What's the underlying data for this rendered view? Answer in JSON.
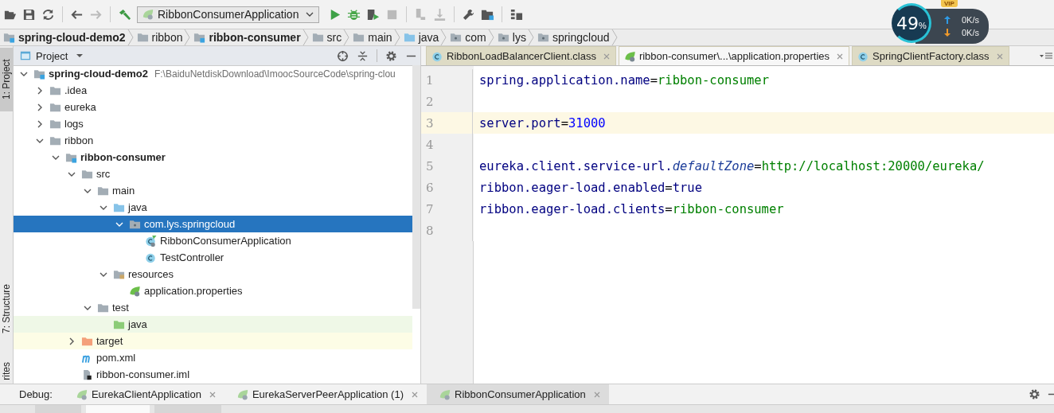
{
  "toolbar": {
    "items": [
      {
        "kind": "open",
        "disabled": false
      },
      {
        "kind": "save",
        "disabled": false
      },
      {
        "kind": "sync",
        "disabled": false
      },
      {
        "kind": "separator"
      },
      {
        "kind": "back",
        "disabled": false
      },
      {
        "kind": "forward",
        "disabled": true
      },
      {
        "kind": "separator"
      },
      {
        "kind": "build",
        "disabled": false
      },
      {
        "kind": "run-config",
        "label": "RibbonConsumerApplication"
      },
      {
        "kind": "run",
        "disabled": false
      },
      {
        "kind": "debug",
        "disabled": false
      },
      {
        "kind": "coverage",
        "disabled": false
      },
      {
        "kind": "stop",
        "disabled": true
      },
      {
        "kind": "separator"
      },
      {
        "kind": "attach",
        "disabled": true
      },
      {
        "kind": "deploy",
        "disabled": true
      },
      {
        "kind": "separator"
      },
      {
        "kind": "settings",
        "disabled": false
      },
      {
        "kind": "structure",
        "disabled": false
      },
      {
        "kind": "separator"
      },
      {
        "kind": "tasks",
        "disabled": false
      }
    ]
  },
  "breadcrumbs": [
    {
      "label": "spring-cloud-demo2",
      "kind": "module"
    },
    {
      "label": "ribbon",
      "kind": "folder"
    },
    {
      "label": "ribbon-consumer",
      "kind": "module"
    },
    {
      "label": "src",
      "kind": "folder"
    },
    {
      "label": "main",
      "kind": "folder"
    },
    {
      "label": "java",
      "kind": "source-root"
    },
    {
      "label": "com",
      "kind": "package"
    },
    {
      "label": "lys",
      "kind": "package"
    },
    {
      "label": "springcloud",
      "kind": "package"
    }
  ],
  "side_stripe": {
    "top": "1: Project",
    "middle": "7: Structure",
    "bottom": "rites"
  },
  "project_panel": {
    "title": "Project",
    "tree": [
      {
        "label": "spring-cloud-demo2",
        "kind": "module",
        "hint": "F:\\BaiduNetdiskDownload\\ImoocSourceCode\\spring-clou",
        "expanded": true,
        "selected": false,
        "children": [
          {
            "label": ".idea",
            "kind": "folder",
            "expanded": false,
            "selected": false
          },
          {
            "label": "eureka",
            "kind": "folder",
            "expanded": false,
            "selected": false
          },
          {
            "label": "logs",
            "kind": "folder",
            "expanded": false,
            "selected": false
          },
          {
            "label": "ribbon",
            "kind": "folder",
            "expanded": true,
            "selected": false,
            "children": [
              {
                "label": "ribbon-consumer",
                "kind": "module",
                "expanded": true,
                "selected": false,
                "children": [
                  {
                    "label": "src",
                    "kind": "folder",
                    "expanded": true,
                    "selected": false,
                    "children": [
                      {
                        "label": "main",
                        "kind": "folder",
                        "expanded": true,
                        "selected": false,
                        "children": [
                          {
                            "label": "java",
                            "kind": "source-root",
                            "expanded": true,
                            "selected": false,
                            "children": [
                              {
                                "label": "com.lys.springcloud",
                                "kind": "package",
                                "expanded": true,
                                "selected": true,
                                "children": [
                                  {
                                    "label": "RibbonConsumerApplication",
                                    "kind": "spring-class",
                                    "selected": false
                                  },
                                  {
                                    "label": "TestController",
                                    "kind": "class",
                                    "selected": false
                                  }
                                ]
                              }
                            ]
                          },
                          {
                            "label": "resources",
                            "kind": "resources",
                            "expanded": true,
                            "selected": false,
                            "children": [
                              {
                                "label": "application.properties",
                                "kind": "properties",
                                "selected": false
                              }
                            ]
                          }
                        ]
                      },
                      {
                        "label": "test",
                        "kind": "folder",
                        "expanded": true,
                        "selected": false,
                        "children": [
                          {
                            "label": "java",
                            "kind": "test-root",
                            "selected": false
                          }
                        ]
                      }
                    ]
                  },
                  {
                    "label": "target",
                    "kind": "excluded",
                    "expanded": false,
                    "selected": false
                  },
                  {
                    "label": "pom.xml",
                    "kind": "maven",
                    "selected": false
                  },
                  {
                    "label": "ribbon-consumer.iml",
                    "kind": "iml",
                    "selected": false
                  }
                ]
              }
            ]
          }
        ]
      }
    ]
  },
  "editor": {
    "tabs": [
      {
        "label": "RibbonLoadBalancerClient.class",
        "kind": "class",
        "selected": false
      },
      {
        "label": "ribbon-consumer\\...\\application.properties",
        "kind": "properties",
        "selected": true
      },
      {
        "label": "SpringClientFactory.class",
        "kind": "class",
        "selected": false
      }
    ],
    "lines": [
      {
        "number": "1",
        "current": false,
        "tokens": [
          {
            "text": "spring.application.name",
            "kind": "key"
          },
          {
            "text": "=",
            "kind": "sep"
          },
          {
            "text": "ribbon-consumer",
            "kind": "string"
          }
        ]
      },
      {
        "number": "2",
        "current": false
      },
      {
        "number": "3",
        "current": true,
        "tokens": [
          {
            "text": "server.port",
            "kind": "key"
          },
          {
            "text": "=",
            "kind": "sep"
          },
          {
            "text": "31000",
            "kind": "number"
          }
        ]
      },
      {
        "number": "4",
        "current": false
      },
      {
        "number": "5",
        "current": false,
        "tokens": [
          {
            "text": "eureka.client.service-url.",
            "kind": "key"
          },
          {
            "text": "defaultZone",
            "kind": "map-key"
          },
          {
            "text": "=",
            "kind": "sep"
          },
          {
            "text": "http://localhost:20000/eureka/",
            "kind": "string"
          }
        ]
      },
      {
        "number": "6",
        "current": false,
        "tokens": [
          {
            "text": "ribbon.eager-load.enabled",
            "kind": "key"
          },
          {
            "text": "=",
            "kind": "sep"
          },
          {
            "text": "true",
            "kind": "keyword"
          }
        ]
      },
      {
        "number": "7",
        "current": false,
        "tokens": [
          {
            "text": "ribbon.eager-load.clients",
            "kind": "key"
          },
          {
            "text": "=",
            "kind": "sep"
          },
          {
            "text": "ribbon-consumer",
            "kind": "string"
          }
        ]
      },
      {
        "number": "8",
        "current": false
      }
    ]
  },
  "debug_bar": {
    "label": "Debug:",
    "tabs": [
      {
        "label": "EurekaClientApplication",
        "selected": false
      },
      {
        "label": "EurekaServerPeerApplication (1)",
        "selected": false
      },
      {
        "label": "RibbonConsumerApplication",
        "selected": true
      }
    ]
  },
  "net_monitor": {
    "percent": "49",
    "unit": "%",
    "upload": "0K/s",
    "download": "0K/s",
    "badge": "VIP"
  }
}
